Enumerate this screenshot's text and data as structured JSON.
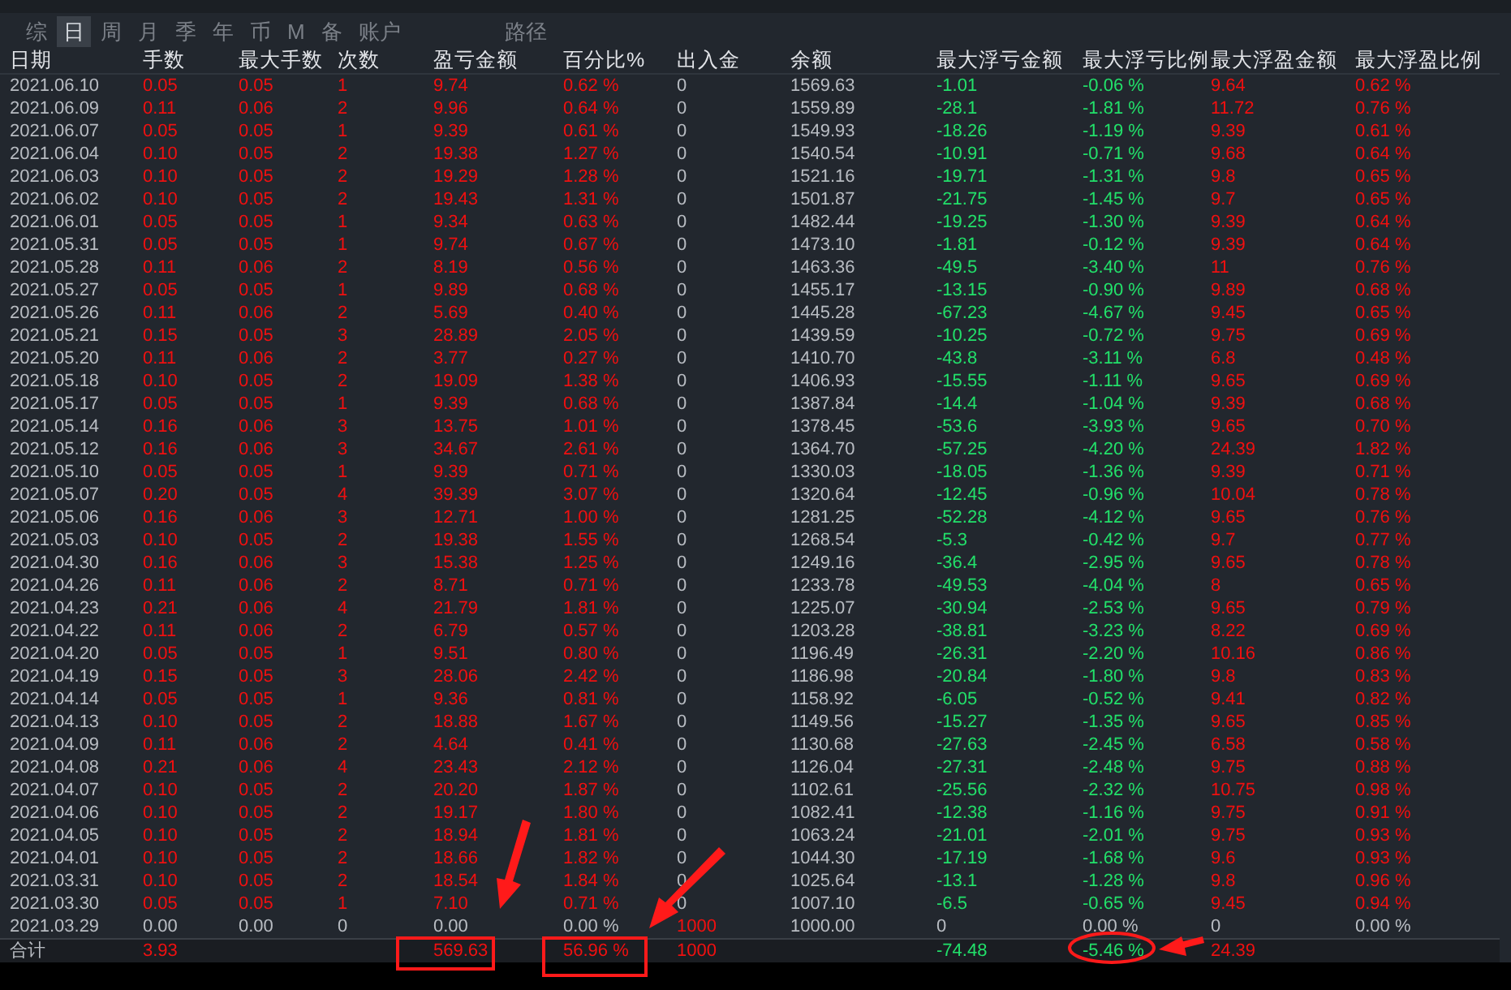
{
  "tabs": [
    {
      "label": "综",
      "selected": false
    },
    {
      "label": "日",
      "selected": true
    },
    {
      "label": "周",
      "selected": false
    },
    {
      "label": "月",
      "selected": false
    },
    {
      "label": "季",
      "selected": false
    },
    {
      "label": "年",
      "selected": false
    },
    {
      "label": "币",
      "selected": false
    },
    {
      "label": "M",
      "selected": false
    },
    {
      "label": "备",
      "selected": false
    },
    {
      "label": "账户",
      "selected": false
    },
    {
      "label": "路径",
      "selected": false
    }
  ],
  "table": {
    "columns": [
      {
        "label": "日期",
        "kind": "text"
      },
      {
        "label": "手数",
        "kind": "gain"
      },
      {
        "label": "最大手数",
        "kind": "gain"
      },
      {
        "label": "次数",
        "kind": "gain"
      },
      {
        "label": "盈亏金额",
        "kind": "gain"
      },
      {
        "label": "百分比%",
        "kind": "gain"
      },
      {
        "label": "出入金",
        "kind": "flow"
      },
      {
        "label": "余额",
        "kind": "text"
      },
      {
        "label": "最大浮亏金额",
        "kind": "loss"
      },
      {
        "label": "最大浮亏比例",
        "kind": "loss"
      },
      {
        "label": "最大浮盈金额",
        "kind": "gain"
      },
      {
        "label": "最大浮盈比例",
        "kind": "gain"
      }
    ],
    "rows": [
      {
        "kind": "trade",
        "cells": [
          "2021.06.10",
          "0.05",
          "0.05",
          "1",
          "9.74",
          "0.62 %",
          "0",
          "1569.63",
          "-1.01",
          "-0.06 %",
          "9.64",
          "0.62 %"
        ]
      },
      {
        "kind": "trade",
        "cells": [
          "2021.06.09",
          "0.11",
          "0.06",
          "2",
          "9.96",
          "0.64 %",
          "0",
          "1559.89",
          "-28.1",
          "-1.81 %",
          "11.72",
          "0.76 %"
        ]
      },
      {
        "kind": "trade",
        "cells": [
          "2021.06.07",
          "0.05",
          "0.05",
          "1",
          "9.39",
          "0.61 %",
          "0",
          "1549.93",
          "-18.26",
          "-1.19 %",
          "9.39",
          "0.61 %"
        ]
      },
      {
        "kind": "trade",
        "cells": [
          "2021.06.04",
          "0.10",
          "0.05",
          "2",
          "19.38",
          "1.27 %",
          "0",
          "1540.54",
          "-10.91",
          "-0.71 %",
          "9.68",
          "0.64 %"
        ]
      },
      {
        "kind": "trade",
        "cells": [
          "2021.06.03",
          "0.10",
          "0.05",
          "2",
          "19.29",
          "1.28 %",
          "0",
          "1521.16",
          "-19.71",
          "-1.31 %",
          "9.8",
          "0.65 %"
        ]
      },
      {
        "kind": "trade",
        "cells": [
          "2021.06.02",
          "0.10",
          "0.05",
          "2",
          "19.43",
          "1.31 %",
          "0",
          "1501.87",
          "-21.75",
          "-1.45 %",
          "9.7",
          "0.65 %"
        ]
      },
      {
        "kind": "trade",
        "cells": [
          "2021.06.01",
          "0.05",
          "0.05",
          "1",
          "9.34",
          "0.63 %",
          "0",
          "1482.44",
          "-19.25",
          "-1.30 %",
          "9.39",
          "0.64 %"
        ]
      },
      {
        "kind": "trade",
        "cells": [
          "2021.05.31",
          "0.05",
          "0.05",
          "1",
          "9.74",
          "0.67 %",
          "0",
          "1473.10",
          "-1.81",
          "-0.12 %",
          "9.39",
          "0.64 %"
        ]
      },
      {
        "kind": "trade",
        "cells": [
          "2021.05.28",
          "0.11",
          "0.06",
          "2",
          "8.19",
          "0.56 %",
          "0",
          "1463.36",
          "-49.5",
          "-3.40 %",
          "11",
          "0.76 %"
        ]
      },
      {
        "kind": "trade",
        "cells": [
          "2021.05.27",
          "0.05",
          "0.05",
          "1",
          "9.89",
          "0.68 %",
          "0",
          "1455.17",
          "-13.15",
          "-0.90 %",
          "9.89",
          "0.68 %"
        ]
      },
      {
        "kind": "trade",
        "cells": [
          "2021.05.26",
          "0.11",
          "0.06",
          "2",
          "5.69",
          "0.40 %",
          "0",
          "1445.28",
          "-67.23",
          "-4.67 %",
          "9.45",
          "0.65 %"
        ]
      },
      {
        "kind": "trade",
        "cells": [
          "2021.05.21",
          "0.15",
          "0.05",
          "3",
          "28.89",
          "2.05 %",
          "0",
          "1439.59",
          "-10.25",
          "-0.72 %",
          "9.75",
          "0.69 %"
        ]
      },
      {
        "kind": "trade",
        "cells": [
          "2021.05.20",
          "0.11",
          "0.06",
          "2",
          "3.77",
          "0.27 %",
          "0",
          "1410.70",
          "-43.8",
          "-3.11 %",
          "6.8",
          "0.48 %"
        ]
      },
      {
        "kind": "trade",
        "cells": [
          "2021.05.18",
          "0.10",
          "0.05",
          "2",
          "19.09",
          "1.38 %",
          "0",
          "1406.93",
          "-15.55",
          "-1.11 %",
          "9.65",
          "0.69 %"
        ]
      },
      {
        "kind": "trade",
        "cells": [
          "2021.05.17",
          "0.05",
          "0.05",
          "1",
          "9.39",
          "0.68 %",
          "0",
          "1387.84",
          "-14.4",
          "-1.04 %",
          "9.39",
          "0.68 %"
        ]
      },
      {
        "kind": "trade",
        "cells": [
          "2021.05.14",
          "0.16",
          "0.06",
          "3",
          "13.75",
          "1.01 %",
          "0",
          "1378.45",
          "-53.6",
          "-3.93 %",
          "9.65",
          "0.70 %"
        ]
      },
      {
        "kind": "trade",
        "cells": [
          "2021.05.12",
          "0.16",
          "0.06",
          "3",
          "34.67",
          "2.61 %",
          "0",
          "1364.70",
          "-57.25",
          "-4.20 %",
          "24.39",
          "1.82 %"
        ]
      },
      {
        "kind": "trade",
        "cells": [
          "2021.05.10",
          "0.05",
          "0.05",
          "1",
          "9.39",
          "0.71 %",
          "0",
          "1330.03",
          "-18.05",
          "-1.36 %",
          "9.39",
          "0.71 %"
        ]
      },
      {
        "kind": "trade",
        "cells": [
          "2021.05.07",
          "0.20",
          "0.05",
          "4",
          "39.39",
          "3.07 %",
          "0",
          "1320.64",
          "-12.45",
          "-0.96 %",
          "10.04",
          "0.78 %"
        ]
      },
      {
        "kind": "trade",
        "cells": [
          "2021.05.06",
          "0.16",
          "0.06",
          "3",
          "12.71",
          "1.00 %",
          "0",
          "1281.25",
          "-52.28",
          "-4.12 %",
          "9.65",
          "0.76 %"
        ]
      },
      {
        "kind": "trade",
        "cells": [
          "2021.05.03",
          "0.10",
          "0.05",
          "2",
          "19.38",
          "1.55 %",
          "0",
          "1268.54",
          "-5.3",
          "-0.42 %",
          "9.7",
          "0.77 %"
        ]
      },
      {
        "kind": "trade",
        "cells": [
          "2021.04.30",
          "0.16",
          "0.06",
          "3",
          "15.38",
          "1.25 %",
          "0",
          "1249.16",
          "-36.4",
          "-2.95 %",
          "9.65",
          "0.78 %"
        ]
      },
      {
        "kind": "trade",
        "cells": [
          "2021.04.26",
          "0.11",
          "0.06",
          "2",
          "8.71",
          "0.71 %",
          "0",
          "1233.78",
          "-49.53",
          "-4.04 %",
          "8",
          "0.65 %"
        ]
      },
      {
        "kind": "trade",
        "cells": [
          "2021.04.23",
          "0.21",
          "0.06",
          "4",
          "21.79",
          "1.81 %",
          "0",
          "1225.07",
          "-30.94",
          "-2.53 %",
          "9.65",
          "0.79 %"
        ]
      },
      {
        "kind": "trade",
        "cells": [
          "2021.04.22",
          "0.11",
          "0.06",
          "2",
          "6.79",
          "0.57 %",
          "0",
          "1203.28",
          "-38.81",
          "-3.23 %",
          "8.22",
          "0.69 %"
        ]
      },
      {
        "kind": "trade",
        "cells": [
          "2021.04.20",
          "0.05",
          "0.05",
          "1",
          "9.51",
          "0.80 %",
          "0",
          "1196.49",
          "-26.31",
          "-2.20 %",
          "10.16",
          "0.86 %"
        ]
      },
      {
        "kind": "trade",
        "cells": [
          "2021.04.19",
          "0.15",
          "0.05",
          "3",
          "28.06",
          "2.42 %",
          "0",
          "1186.98",
          "-20.84",
          "-1.80 %",
          "9.8",
          "0.83 %"
        ]
      },
      {
        "kind": "trade",
        "cells": [
          "2021.04.14",
          "0.05",
          "0.05",
          "1",
          "9.36",
          "0.81 %",
          "0",
          "1158.92",
          "-6.05",
          "-0.52 %",
          "9.41",
          "0.82 %"
        ]
      },
      {
        "kind": "trade",
        "cells": [
          "2021.04.13",
          "0.10",
          "0.05",
          "2",
          "18.88",
          "1.67 %",
          "0",
          "1149.56",
          "-15.27",
          "-1.35 %",
          "9.65",
          "0.85 %"
        ]
      },
      {
        "kind": "trade",
        "cells": [
          "2021.04.09",
          "0.11",
          "0.06",
          "2",
          "4.64",
          "0.41 %",
          "0",
          "1130.68",
          "-27.63",
          "-2.45 %",
          "6.58",
          "0.58 %"
        ]
      },
      {
        "kind": "trade",
        "cells": [
          "2021.04.08",
          "0.21",
          "0.06",
          "4",
          "23.43",
          "2.12 %",
          "0",
          "1126.04",
          "-27.31",
          "-2.48 %",
          "9.75",
          "0.88 %"
        ]
      },
      {
        "kind": "trade",
        "cells": [
          "2021.04.07",
          "0.10",
          "0.05",
          "2",
          "20.20",
          "1.87 %",
          "0",
          "1102.61",
          "-25.56",
          "-2.32 %",
          "10.75",
          "0.98 %"
        ]
      },
      {
        "kind": "trade",
        "cells": [
          "2021.04.06",
          "0.10",
          "0.05",
          "2",
          "19.17",
          "1.80 %",
          "0",
          "1082.41",
          "-12.38",
          "-1.16 %",
          "9.75",
          "0.91 %"
        ]
      },
      {
        "kind": "trade",
        "cells": [
          "2021.04.05",
          "0.10",
          "0.05",
          "2",
          "18.94",
          "1.81 %",
          "0",
          "1063.24",
          "-21.01",
          "-2.01 %",
          "9.75",
          "0.93 %"
        ]
      },
      {
        "kind": "trade",
        "cells": [
          "2021.04.01",
          "0.10",
          "0.05",
          "2",
          "18.66",
          "1.82 %",
          "0",
          "1044.30",
          "-17.19",
          "-1.68 %",
          "9.6",
          "0.93 %"
        ]
      },
      {
        "kind": "trade",
        "cells": [
          "2021.03.31",
          "0.10",
          "0.05",
          "2",
          "18.54",
          "1.84 %",
          "0",
          "1025.64",
          "-13.1",
          "-1.28 %",
          "9.8",
          "0.96 %"
        ]
      },
      {
        "kind": "trade",
        "cells": [
          "2021.03.30",
          "0.05",
          "0.05",
          "1",
          "7.10",
          "0.71 %",
          "0",
          "1007.10",
          "-6.5",
          "-0.65 %",
          "9.45",
          "0.94 %"
        ]
      },
      {
        "kind": "deposit",
        "cells": [
          "2021.03.29",
          "0.00",
          "0.00",
          "0",
          "0.00",
          "0.00 %",
          "1000",
          "1000.00",
          "0",
          "0.00 %",
          "0",
          "0.00 %"
        ]
      }
    ],
    "total": {
      "label": "合计",
      "lots": "3.93",
      "profit": "569.63",
      "percent": "56.96 %",
      "flow": "1000",
      "max_float_loss": "-74.48",
      "max_float_loss_pct": "-5.46 %",
      "max_float_profit": "24.39"
    }
  }
}
